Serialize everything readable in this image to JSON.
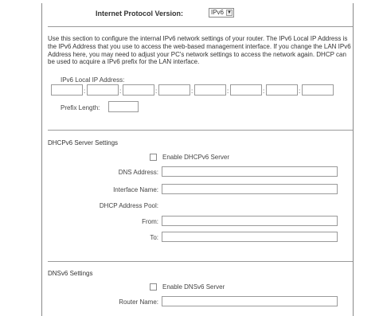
{
  "protocol": {
    "label": "Internet Protocol Version:",
    "selected": "IPv6"
  },
  "lan": {
    "description": "Use this section to configure the internal IPv6 network settings of your router. The IPv6 Local IP Address is the IPv6 Address that you use to access the web-based management interface. If you change the LAN IPv6 Address here, you may need to adjust your PC's network settings to access the network again. DHCP can be used to acquire a IPv6 prefix for the LAN interface.",
    "address_label": "IPv6 Local IP Address:",
    "prefix_label": "Prefix Length:",
    "separator": ":",
    "address_segments": [
      "",
      "",
      "",
      "",
      "",
      "",
      "",
      ""
    ],
    "prefix_value": ""
  },
  "dhcp": {
    "title": "DHCPv6 Server Settings",
    "enable_label": "Enable DHCPv6 Server",
    "enabled": false,
    "dns_label": "DNS Address:",
    "dns_value": "",
    "iface_label": "Interface Name:",
    "iface_value": "",
    "pool_label": "DHCP Address Pool:",
    "from_label": "From:",
    "from_value": "",
    "to_label": "To:",
    "to_value": ""
  },
  "dns": {
    "title": "DNSv6 Settings",
    "enable_label": "Enable DNSv6 Server",
    "enabled": false,
    "router_label": "Router Name:",
    "router_value": ""
  }
}
